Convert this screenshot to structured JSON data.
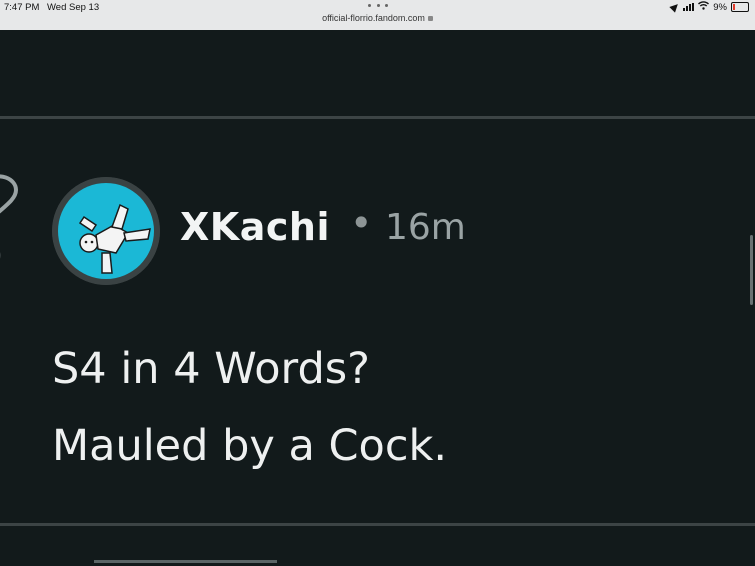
{
  "status_bar": {
    "time": "7:47 PM",
    "date": "Wed Sep 13",
    "url": "official-florrio.fandom.com",
    "battery": "9%"
  },
  "post": {
    "username": "XKachi",
    "separator": "•",
    "time_ago": "16m",
    "title": "S4 in 4 Words?",
    "body": "Mauled by a Cock."
  },
  "colors": {
    "background": "#121a1b",
    "avatar_bg": "#1bb8d6"
  },
  "icons": [
    "location-icon",
    "signal-icon",
    "wifi-icon",
    "battery-icon",
    "heart-icon",
    "lock-icon"
  ]
}
